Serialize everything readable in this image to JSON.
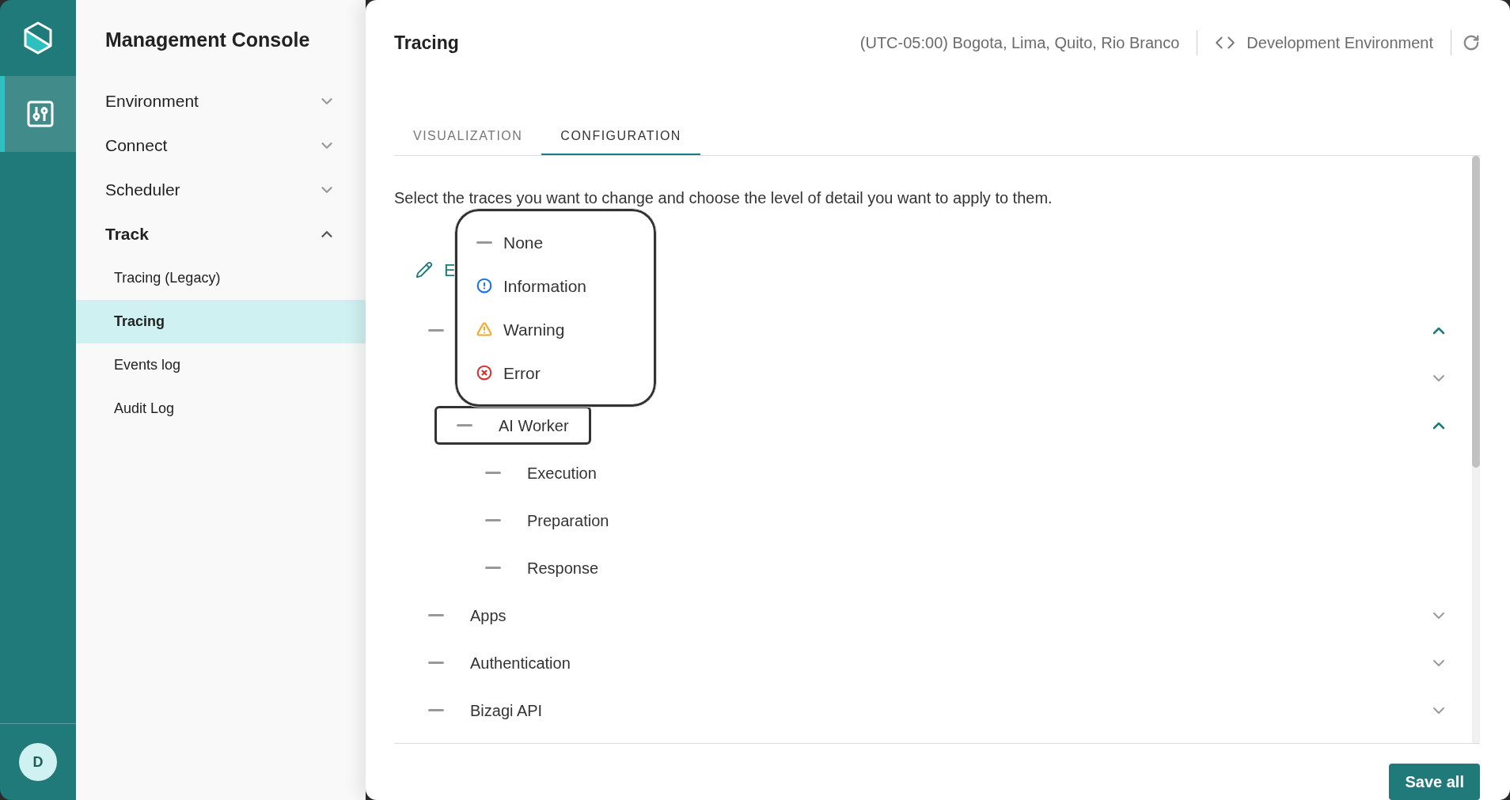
{
  "rail": {
    "tools": [
      {
        "selected": true
      }
    ],
    "avatar": "D"
  },
  "sidebar": {
    "title": "Management Console",
    "items": [
      {
        "label": "Environment",
        "expanded": false
      },
      {
        "label": "Connect",
        "expanded": false
      },
      {
        "label": "Scheduler",
        "expanded": false
      },
      {
        "label": "Track",
        "expanded": true,
        "children": [
          {
            "label": "Tracing (Legacy)",
            "selected": false
          },
          {
            "label": "Tracing",
            "selected": true
          },
          {
            "label": "Events log",
            "selected": false
          },
          {
            "label": "Audit Log",
            "selected": false
          }
        ]
      }
    ]
  },
  "header": {
    "title": "Tracing",
    "timezone": "(UTC-05:00) Bogota, Lima, Quito, Rio Branco",
    "environment": "Development Environment"
  },
  "tabs": [
    {
      "label": "VISUALIZATION",
      "selected": false
    },
    {
      "label": "CONFIGURATION",
      "selected": true
    }
  ],
  "description": "Select the traces you want to change and choose the level of detail you want to apply to them.",
  "edit_link": "E",
  "tree": [
    {
      "kind": "none",
      "expanded": true,
      "children": [
        {
          "expanded": false
        },
        {
          "label": "AI Worker",
          "kind": "none",
          "expanded": true,
          "focused": true,
          "children": [
            {
              "label": "Execution",
              "kind": "none"
            },
            {
              "label": "Preparation",
              "kind": "none"
            },
            {
              "label": "Response",
              "kind": "none"
            }
          ]
        }
      ]
    },
    {
      "label": "Apps",
      "kind": "none",
      "expanded": false
    },
    {
      "label": "Authentication",
      "kind": "none",
      "expanded": false
    },
    {
      "label": "Bizagi API",
      "kind": "none",
      "expanded": false
    }
  ],
  "level_menu": [
    {
      "label": "None",
      "kind": "none"
    },
    {
      "label": "Information",
      "kind": "information"
    },
    {
      "label": "Warning",
      "kind": "warning"
    },
    {
      "label": "Error",
      "kind": "error"
    }
  ],
  "save_button": "Save all"
}
